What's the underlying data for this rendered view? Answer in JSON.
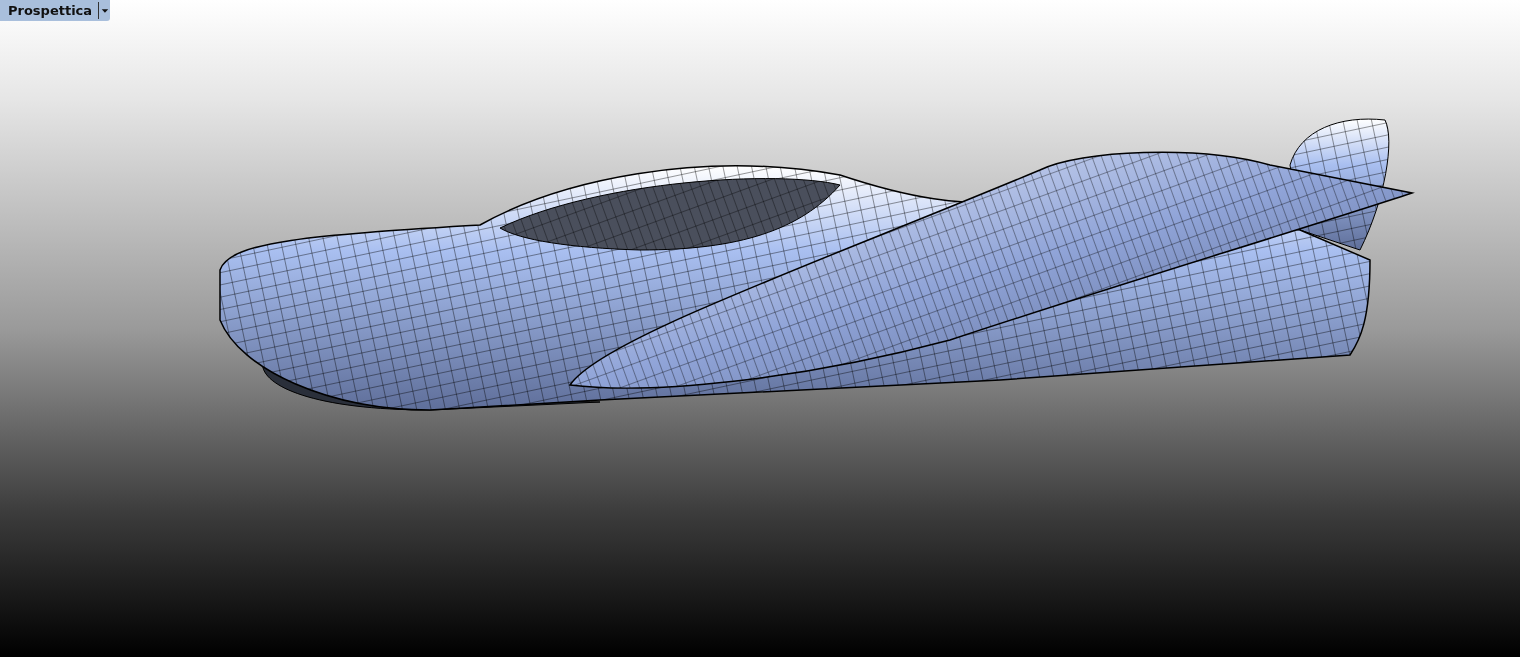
{
  "viewport": {
    "title": "Prospettica"
  }
}
